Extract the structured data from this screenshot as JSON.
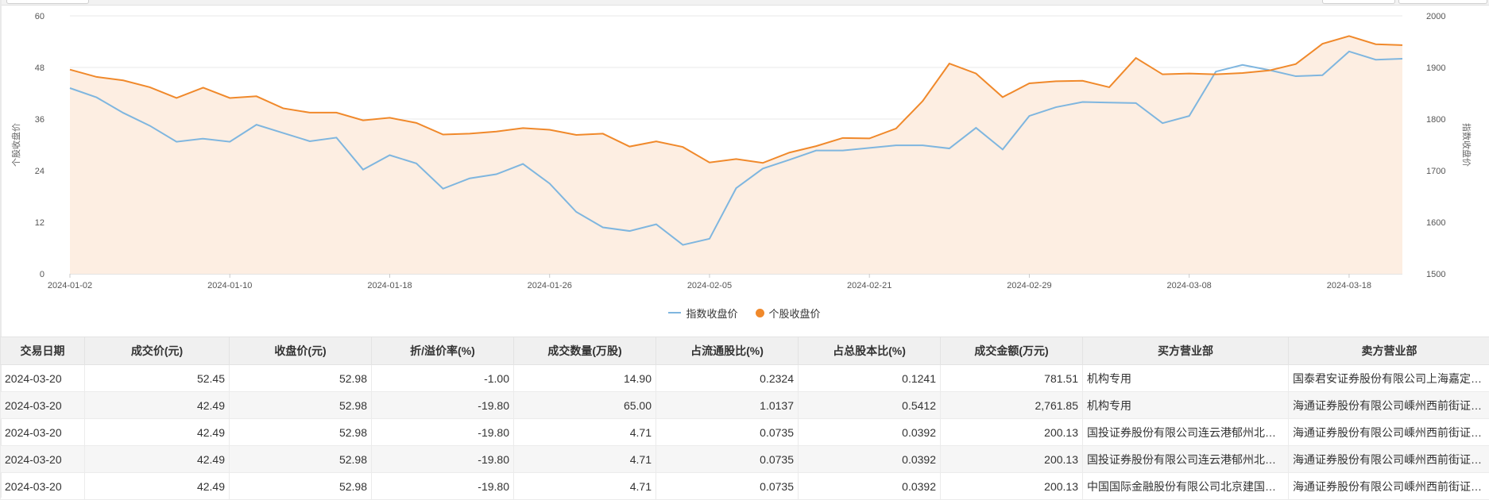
{
  "chart_data": {
    "type": "line",
    "left_axis": {
      "label": "个股收盘价",
      "min": 0,
      "max": 60,
      "ticks": [
        "0",
        "12",
        "24",
        "36",
        "48",
        "60"
      ]
    },
    "right_axis": {
      "label": "指数收盘价",
      "min": 1500,
      "max": 2000,
      "ticks": [
        "1500",
        "1600",
        "1700",
        "1800",
        "1900",
        "2000"
      ]
    },
    "x_ticks": [
      {
        "i": 0,
        "label": "2024-01-02"
      },
      {
        "i": 6,
        "label": "2024-01-10"
      },
      {
        "i": 12,
        "label": "2024-01-18"
      },
      {
        "i": 18,
        "label": "2024-01-26"
      },
      {
        "i": 24,
        "label": "2024-02-05"
      },
      {
        "i": 30,
        "label": "2024-02-21"
      },
      {
        "i": 36,
        "label": "2024-02-29"
      },
      {
        "i": 42,
        "label": "2024-03-08"
      },
      {
        "i": 48,
        "label": "2024-03-18"
      }
    ],
    "n_points": 51,
    "grid": true,
    "legend_position": "bottom-center",
    "series": [
      {
        "name": "指数收盘价",
        "axis": "right",
        "color": "#7fb6df",
        "marker": "line",
        "values": [
          1860,
          1842,
          1812,
          1787,
          1756,
          1762,
          1756,
          1789,
          1773,
          1757,
          1764,
          1702,
          1730,
          1714,
          1665,
          1685,
          1693,
          1713,
          1675,
          1620,
          1590,
          1583,
          1596,
          1556,
          1568,
          1666,
          1704,
          1721,
          1739,
          1739,
          1744,
          1749,
          1749,
          1743,
          1783,
          1741,
          1806,
          1823,
          1833,
          1832,
          1831,
          1792,
          1806,
          1892,
          1905,
          1895,
          1883,
          1885,
          1931,
          1915,
          1917
        ]
      },
      {
        "name": "个股收盘价",
        "axis": "left",
        "color": "#f0892b",
        "marker": "dot",
        "fill": "#fdeee2",
        "values": [
          47.5,
          45.8,
          45.0,
          43.4,
          40.9,
          43.3,
          40.9,
          41.3,
          38.5,
          37.5,
          37.5,
          35.7,
          36.3,
          35.1,
          32.4,
          32.6,
          33.1,
          33.9,
          33.5,
          32.3,
          32.6,
          29.6,
          30.8,
          29.5,
          25.9,
          26.7,
          25.8,
          28.2,
          29.7,
          31.6,
          31.5,
          33.8,
          40.2,
          48.9,
          46.6,
          41.1,
          44.3,
          44.8,
          44.9,
          43.4,
          50.2,
          46.4,
          46.6,
          46.4,
          46.7,
          47.3,
          48.8,
          53.5,
          55.3,
          53.4,
          53.2
        ]
      }
    ]
  },
  "legend": {
    "index_label": "指数收盘价",
    "stock_label": "个股收盘价"
  },
  "table": {
    "headers": [
      "交易日期",
      "成交价(元)",
      "收盘价(元)",
      "折/溢价率(%)",
      "成交数量(万股)",
      "占流通股比(%)",
      "占总股本比(%)",
      "成交金额(万元)",
      "买方营业部",
      "卖方营业部"
    ],
    "rows": [
      [
        "2024-03-20",
        "52.45",
        "52.98",
        "-1.00",
        "14.90",
        "0.2324",
        "0.1241",
        "781.51",
        "机构专用",
        "国泰君安证券股份有限公司上海嘉定区金沙江西路证券营业部"
      ],
      [
        "2024-03-20",
        "42.49",
        "52.98",
        "-19.80",
        "65.00",
        "1.0137",
        "0.5412",
        "2,761.85",
        "机构专用",
        "海通证券股份有限公司嵊州西前街证券营业部"
      ],
      [
        "2024-03-20",
        "42.49",
        "52.98",
        "-19.80",
        "4.71",
        "0.0735",
        "0.0392",
        "200.13",
        "国投证券股份有限公司连云港郁州北路证券营业部",
        "海通证券股份有限公司嵊州西前街证券营业部"
      ],
      [
        "2024-03-20",
        "42.49",
        "52.98",
        "-19.80",
        "4.71",
        "0.0735",
        "0.0392",
        "200.13",
        "国投证券股份有限公司连云港郁州北路证券营业部",
        "海通证券股份有限公司嵊州西前街证券营业部"
      ],
      [
        "2024-03-20",
        "42.49",
        "52.98",
        "-19.80",
        "4.71",
        "0.0735",
        "0.0392",
        "200.13",
        "中国国际金融股份有限公司北京建国门外大街证券营业部",
        "海通证券股份有限公司嵊州西前街证券营业部"
      ]
    ]
  }
}
